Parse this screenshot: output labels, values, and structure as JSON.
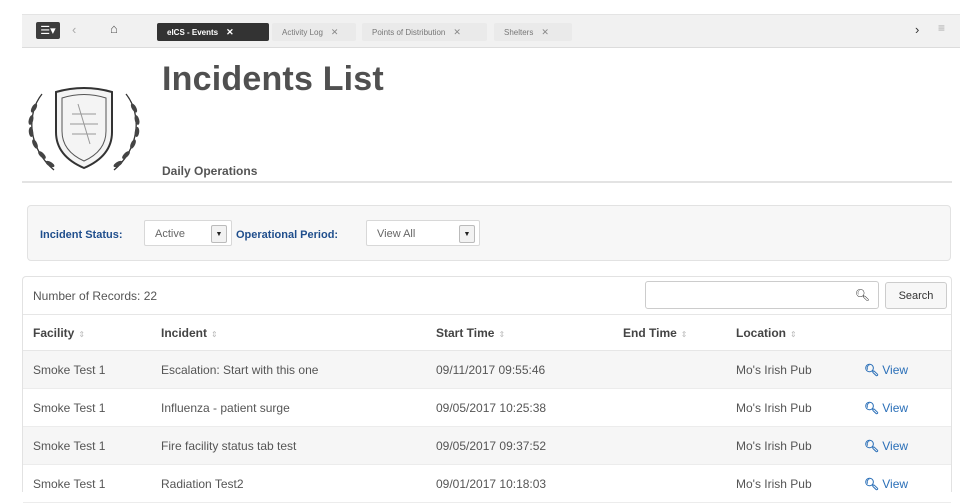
{
  "tabbar": {
    "menu_icon": "menu-icon",
    "tabs": [
      {
        "label": "eICS - Events",
        "active": true
      },
      {
        "label": "Activity Log",
        "active": false
      },
      {
        "label": "Points of Distribution",
        "active": false
      },
      {
        "label": "Shelters",
        "active": false
      }
    ],
    "close_glyph": "✕"
  },
  "header": {
    "title": "Incidents List",
    "subtitle": "Daily Operations"
  },
  "filters": {
    "status_label": "Incident Status:",
    "status_value": "Active",
    "period_label": "Operational Period:",
    "period_value": "View All"
  },
  "records": {
    "count_text": "Number of Records: 22",
    "search_button": "Search",
    "search_placeholder": "",
    "columns": [
      "Facility",
      "Incident",
      "Start Time",
      "End Time",
      "Location",
      ""
    ],
    "rows": [
      {
        "facility": "Smoke Test 1",
        "incident": "Escalation: Start with this one",
        "start": "09/11/2017 09:55:46",
        "end": "",
        "location": "Mo's Irish Pub",
        "action": "View"
      },
      {
        "facility": "Smoke Test 1",
        "incident": "Influenza - patient surge",
        "start": "09/05/2017 10:25:38",
        "end": "",
        "location": "Mo's Irish Pub",
        "action": "View"
      },
      {
        "facility": "Smoke Test 1",
        "incident": "Fire facility status tab test",
        "start": "09/05/2017 09:37:52",
        "end": "",
        "location": "Mo's Irish Pub",
        "action": "View"
      },
      {
        "facility": "Smoke Test 1",
        "incident": "Radiation Test2",
        "start": "09/01/2017 10:18:03",
        "end": "",
        "location": "Mo's Irish Pub",
        "action": "View"
      }
    ]
  },
  "colors": {
    "accent": "#1f4e8c",
    "link": "#2a6fb8",
    "active_tab": "#333333"
  }
}
